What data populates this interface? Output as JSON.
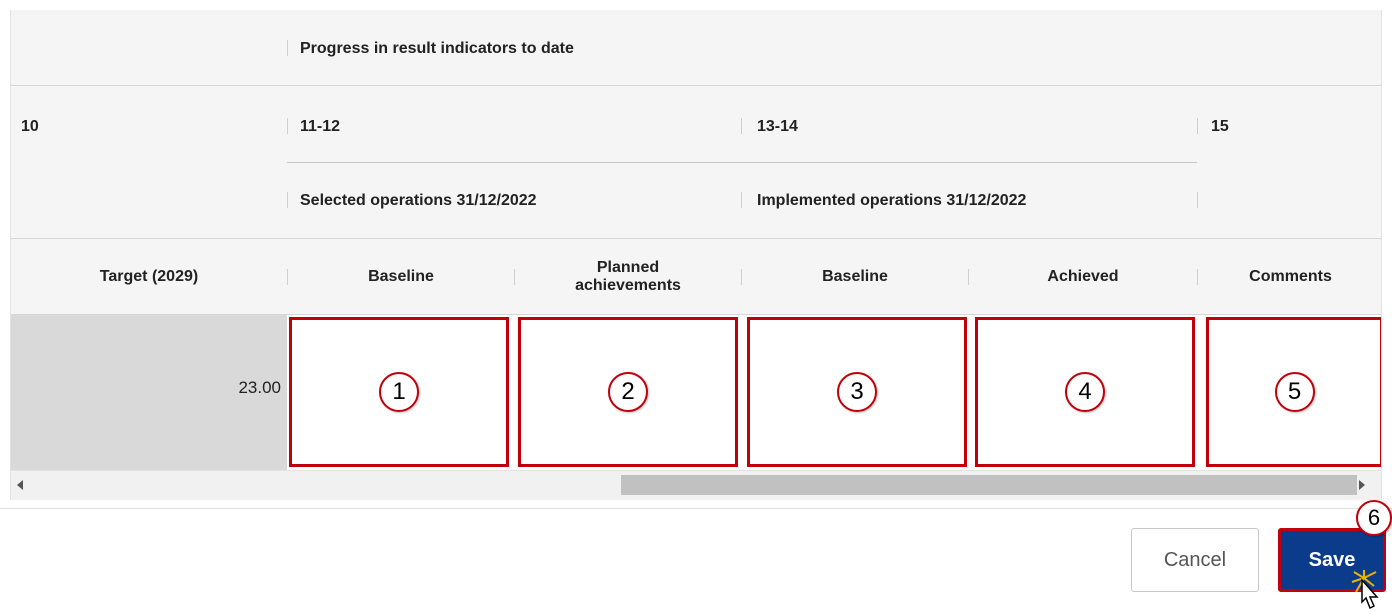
{
  "header": {
    "progress_title": "Progress in result indicators to date",
    "col_10": "10",
    "col_11_12": "11-12",
    "col_13_14": "13-14",
    "col_15": "15",
    "selected_ops": "Selected operations 31/12/2022",
    "implemented_ops": "Implemented operations 31/12/2022"
  },
  "columns": {
    "target": "Target (2029)",
    "baseline_1": "Baseline",
    "planned": "Planned achievements",
    "baseline_2": "Baseline",
    "achieved": "Achieved",
    "comments": "Comments"
  },
  "row": {
    "target_value": "23.00",
    "markers": [
      "1",
      "2",
      "3",
      "4",
      "5"
    ]
  },
  "footer": {
    "cancel_label": "Cancel",
    "save_label": "Save",
    "save_marker": "6"
  },
  "colors": {
    "highlight": "#c0000a",
    "save_bg": "#0b3c8c",
    "header_bg": "#f5f5f5",
    "target_bg": "#d9d9d9"
  }
}
